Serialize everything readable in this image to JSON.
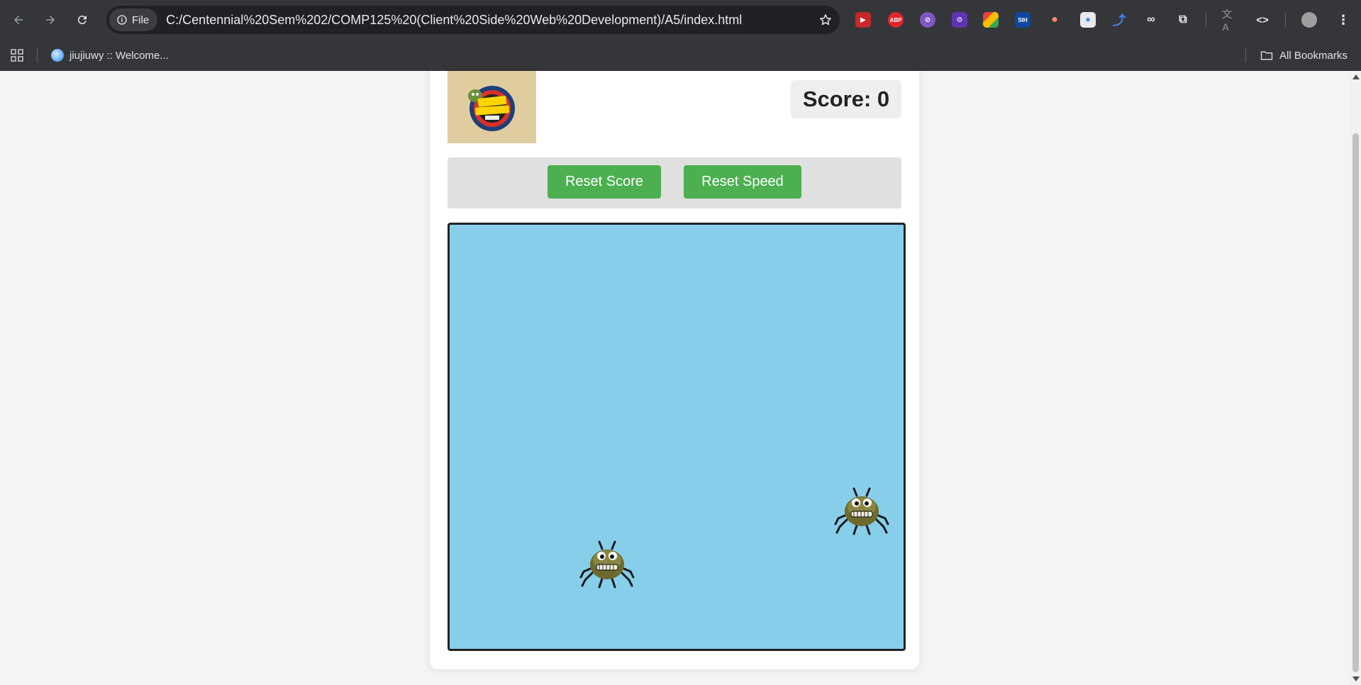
{
  "browser": {
    "chip_label": "File",
    "url": "C:/Centennial%20Sem%202/COMP125%20(Client%20Side%20Web%20Development)/A5/index.html",
    "extensions": [
      {
        "icon": "youtube-red-icon",
        "color": "#e53935",
        "text": "▶"
      },
      {
        "icon": "adblock-plus-icon",
        "color": "#e0262b",
        "text": "ABP"
      },
      {
        "icon": "compass-icon",
        "color": "#7e57c2",
        "text": "⊘"
      },
      {
        "icon": "gear-extension-icon",
        "color": "#5e35b1",
        "text": "⚙"
      },
      {
        "icon": "color-grid-icon",
        "color": "#fbbc04",
        "text": ""
      },
      {
        "icon": "sih-icon",
        "color": "#1a73e8",
        "text": "SIH"
      },
      {
        "icon": "capsule-icon",
        "color": "#ff8a65",
        "text": "●"
      },
      {
        "icon": "window-star-icon",
        "color": "#e8eaed",
        "text": ""
      },
      {
        "icon": "arrow-extension-icon",
        "color": "#1a73e8",
        "text": "⤴"
      },
      {
        "icon": "glasses-icon",
        "color": "#e8eaed",
        "text": "∞"
      },
      {
        "icon": "puzzle-icon",
        "color": "#e8eaed",
        "text": "⧉"
      }
    ],
    "bookmarks": {
      "item_label": "jiujiuwy :: Welcome...",
      "all_label": "All Bookmarks"
    }
  },
  "game": {
    "score_label": "Score: 0",
    "reset_score_label": "Reset Score",
    "reset_speed_label": "Reset Speed",
    "logo_alt": "BUG CLICKING GAME",
    "bugs_visible": 2,
    "area_color": "#87ceeb",
    "button_color": "#4caf50"
  }
}
